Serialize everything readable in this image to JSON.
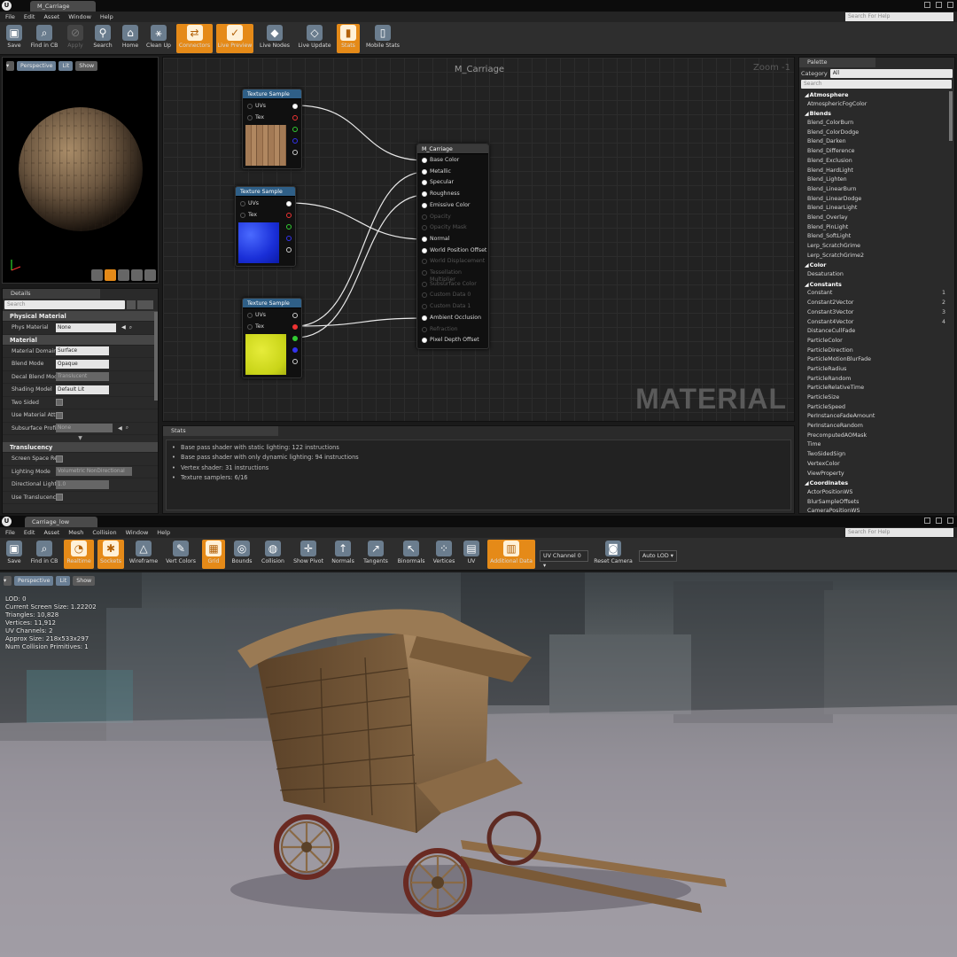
{
  "material_editor": {
    "tab_title": "M_Carriage",
    "menu": [
      "File",
      "Edit",
      "Asset",
      "Window",
      "Help"
    ],
    "search_help_placeholder": "Search For Help",
    "toolbar": [
      "Save",
      "Find in CB",
      "Apply",
      "Search",
      "Home",
      "Clean Up",
      "Connectors",
      "Live Preview",
      "Live Nodes",
      "Live Update",
      "Stats",
      "Mobile Stats"
    ],
    "viewport": {
      "perspective": "Perspective",
      "lit": "Lit",
      "show": "Show"
    },
    "details": {
      "tab": "Details",
      "search_placeholder": "Search",
      "physical_material_header": "Physical Material",
      "phys_material_label": "Phys Material",
      "phys_material_value": "None",
      "material_header": "Material",
      "props": [
        {
          "label": "Material Domain",
          "value": "Surface"
        },
        {
          "label": "Blend Mode",
          "value": "Opaque"
        },
        {
          "label": "Decal Blend Mode",
          "value": "Translucent"
        },
        {
          "label": "Shading Model",
          "value": "Default Lit"
        },
        {
          "label": "Two Sided",
          "value": ""
        },
        {
          "label": "Use Material Attributes",
          "value": ""
        },
        {
          "label": "Subsurface Profile",
          "value": "None"
        }
      ],
      "translucency_header": "Translucency",
      "trans_props": [
        {
          "label": "Screen Space Reflections",
          "value": ""
        },
        {
          "label": "Lighting Mode",
          "value": "Volumetric NonDirectional"
        },
        {
          "label": "Directional Lighting Intensity",
          "value": "1.0"
        },
        {
          "label": "Use Translucency Vertex Fog",
          "value": ""
        }
      ]
    },
    "graph": {
      "title": "M_Carriage",
      "zoom": "Zoom -1",
      "watermark": "MATERIAL",
      "texture_sample_title": "Texture Sample",
      "uvs_label": "UVs",
      "tex_label": "Tex",
      "result_node_title": "M_Carriage",
      "result_pins": [
        {
          "label": "Base Color",
          "active": true
        },
        {
          "label": "Metallic",
          "active": true
        },
        {
          "label": "Specular",
          "active": true
        },
        {
          "label": "Roughness",
          "active": true
        },
        {
          "label": "Emissive Color",
          "active": true
        },
        {
          "label": "Opacity",
          "active": false
        },
        {
          "label": "Opacity Mask",
          "active": false
        },
        {
          "label": "Normal",
          "active": true
        },
        {
          "label": "World Position Offset",
          "active": true
        },
        {
          "label": "World Displacement",
          "active": false
        },
        {
          "label": "Tessellation Multiplier",
          "active": false
        },
        {
          "label": "Subsurface Color",
          "active": false
        },
        {
          "label": "Custom Data 0",
          "active": false
        },
        {
          "label": "Custom Data 1",
          "active": false
        },
        {
          "label": "Ambient Occlusion",
          "active": true
        },
        {
          "label": "Refraction",
          "active": false
        },
        {
          "label": "Pixel Depth Offset",
          "active": true
        }
      ]
    },
    "stats": {
      "tab": "Stats",
      "lines": [
        "Base pass shader with static lighting: 122 instructions",
        "Base pass shader with only dynamic lighting: 94 instructions",
        "Vertex shader: 31 instructions",
        "Texture samplers: 6/16"
      ]
    },
    "palette": {
      "tab": "Palette",
      "category_label": "Category",
      "category_value": "All",
      "search_placeholder": "Search",
      "items": [
        {
          "name": "Atmosphere",
          "head": true,
          "hk": ""
        },
        {
          "name": "AtmosphericFogColor",
          "head": false,
          "hk": ""
        },
        {
          "name": "Blends",
          "head": true,
          "hk": ""
        },
        {
          "name": "Blend_ColorBurn",
          "head": false,
          "hk": ""
        },
        {
          "name": "Blend_ColorDodge",
          "head": false,
          "hk": ""
        },
        {
          "name": "Blend_Darken",
          "head": false,
          "hk": ""
        },
        {
          "name": "Blend_Difference",
          "head": false,
          "hk": ""
        },
        {
          "name": "Blend_Exclusion",
          "head": false,
          "hk": ""
        },
        {
          "name": "Blend_HardLight",
          "head": false,
          "hk": ""
        },
        {
          "name": "Blend_Lighten",
          "head": false,
          "hk": ""
        },
        {
          "name": "Blend_LinearBurn",
          "head": false,
          "hk": ""
        },
        {
          "name": "Blend_LinearDodge",
          "head": false,
          "hk": ""
        },
        {
          "name": "Blend_LinearLight",
          "head": false,
          "hk": ""
        },
        {
          "name": "Blend_Overlay",
          "head": false,
          "hk": ""
        },
        {
          "name": "Blend_PinLight",
          "head": false,
          "hk": ""
        },
        {
          "name": "Blend_SoftLight",
          "head": false,
          "hk": ""
        },
        {
          "name": "Lerp_ScratchGrime",
          "head": false,
          "hk": ""
        },
        {
          "name": "Lerp_ScratchGrime2",
          "head": false,
          "hk": ""
        },
        {
          "name": "Color",
          "head": true,
          "hk": ""
        },
        {
          "name": "Desaturation",
          "head": false,
          "hk": ""
        },
        {
          "name": "Constants",
          "head": true,
          "hk": ""
        },
        {
          "name": "Constant",
          "head": false,
          "hk": "1"
        },
        {
          "name": "Constant2Vector",
          "head": false,
          "hk": "2"
        },
        {
          "name": "Constant3Vector",
          "head": false,
          "hk": "3"
        },
        {
          "name": "Constant4Vector",
          "head": false,
          "hk": "4"
        },
        {
          "name": "DistanceCullFade",
          "head": false,
          "hk": ""
        },
        {
          "name": "ParticleColor",
          "head": false,
          "hk": ""
        },
        {
          "name": "ParticleDirection",
          "head": false,
          "hk": ""
        },
        {
          "name": "ParticleMotionBlurFade",
          "head": false,
          "hk": ""
        },
        {
          "name": "ParticleRadius",
          "head": false,
          "hk": ""
        },
        {
          "name": "ParticleRandom",
          "head": false,
          "hk": ""
        },
        {
          "name": "ParticleRelativeTime",
          "head": false,
          "hk": ""
        },
        {
          "name": "ParticleSize",
          "head": false,
          "hk": ""
        },
        {
          "name": "ParticleSpeed",
          "head": false,
          "hk": ""
        },
        {
          "name": "PerInstanceFadeAmount",
          "head": false,
          "hk": ""
        },
        {
          "name": "PerInstanceRandom",
          "head": false,
          "hk": ""
        },
        {
          "name": "PrecomputedAOMask",
          "head": false,
          "hk": ""
        },
        {
          "name": "Time",
          "head": false,
          "hk": ""
        },
        {
          "name": "TwoSidedSign",
          "head": false,
          "hk": ""
        },
        {
          "name": "VertexColor",
          "head": false,
          "hk": ""
        },
        {
          "name": "ViewProperty",
          "head": false,
          "hk": ""
        },
        {
          "name": "Coordinates",
          "head": true,
          "hk": ""
        },
        {
          "name": "ActorPositionWS",
          "head": false,
          "hk": ""
        },
        {
          "name": "BlurSampleOffsets",
          "head": false,
          "hk": ""
        },
        {
          "name": "CameraPositionWS",
          "head": false,
          "hk": ""
        }
      ]
    }
  },
  "mesh_editor": {
    "tab_title": "Carriage_low",
    "menu": [
      "File",
      "Edit",
      "Asset",
      "Mesh",
      "Collision",
      "Window",
      "Help"
    ],
    "search_help_placeholder": "Search For Help",
    "toolbar": [
      "Save",
      "Find in CB",
      "Realtime",
      "Sockets",
      "Wireframe",
      "Vert Colors",
      "Grid",
      "Bounds",
      "Collision",
      "Show Pivot",
      "Normals",
      "Tangents",
      "Binormals",
      "Vertices",
      "UV",
      "Additional Data",
      "Reset Camera"
    ],
    "uv_channel": "UV Channel 0",
    "auto_lod": "Auto LOD",
    "viewport": {
      "perspective": "Perspective",
      "lit": "Lit",
      "show": "Show"
    },
    "info_lines": [
      "LOD:  0",
      "Current Screen Size:  1.22202",
      "Triangles:  10,828",
      "Vertices:  11,912",
      "UV Channels:  2",
      "Approx Size: 218x533x297",
      "Num Collision Primitives:  1"
    ]
  },
  "colors": {
    "accent": "#e58a18",
    "node_header": "#2f5f87"
  }
}
